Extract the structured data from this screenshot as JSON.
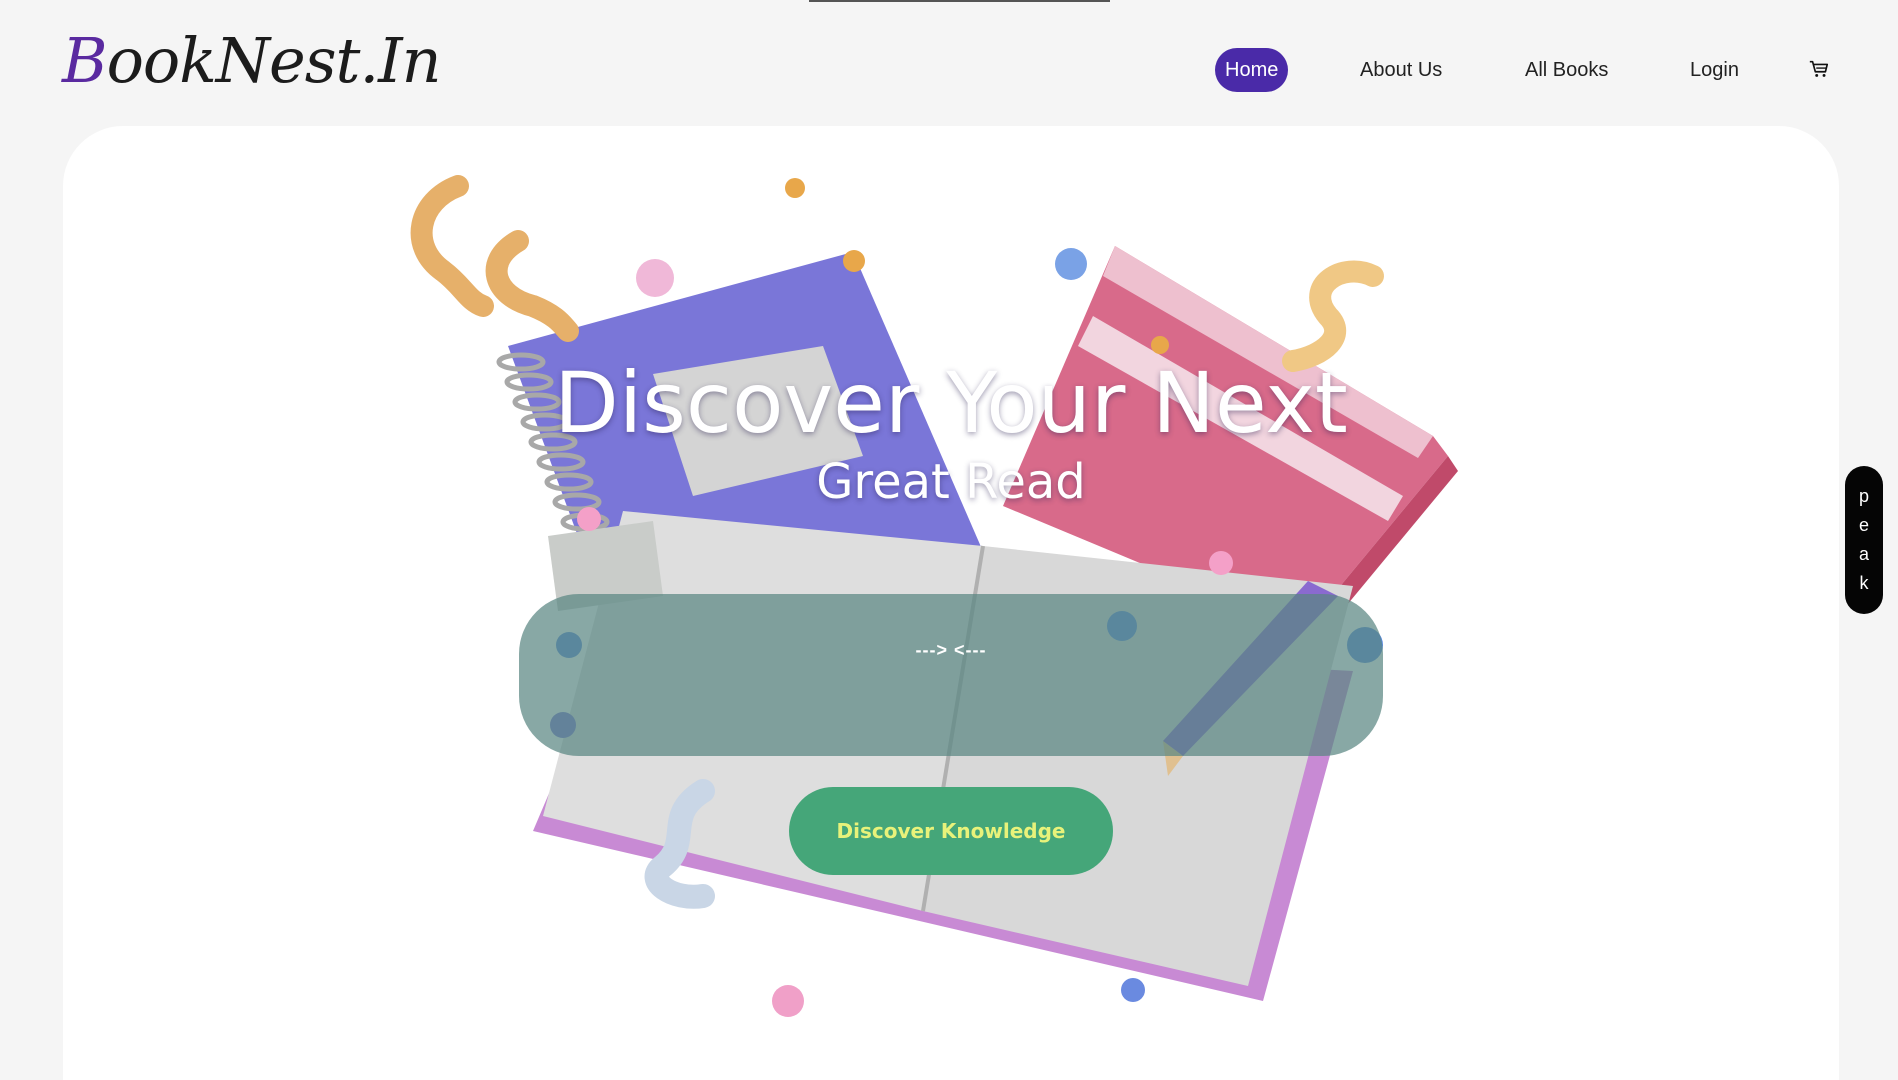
{
  "header": {
    "logo": {
      "capital": "B",
      "rest": "ookNest.In"
    },
    "nav": {
      "home": "Home",
      "about": "About Us",
      "books": "All Books",
      "login": "Login"
    },
    "cart_icon": "cart-icon"
  },
  "hero": {
    "headline": "Discover Your Next",
    "subheadline": "Great Read",
    "search_panel_text": "---> <---",
    "cta_label": "Discover Knowledge",
    "illustration": "books-illustration"
  },
  "side_tab": {
    "letters": [
      "p",
      "e",
      "a",
      "k"
    ]
  },
  "colors": {
    "accent": "#4a2aa8",
    "cta_bg": "#45a679",
    "cta_text": "#e8f27a",
    "panel": "#5a8782"
  }
}
